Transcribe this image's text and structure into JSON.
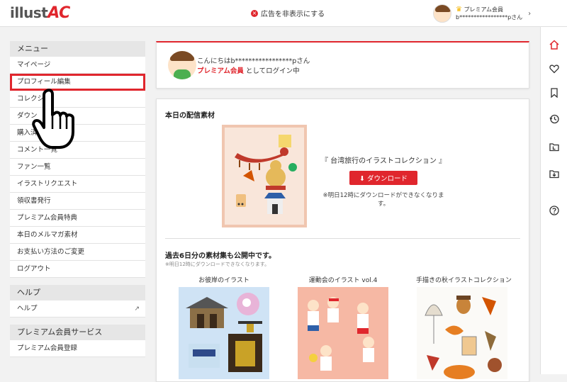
{
  "header": {
    "logo_text": "illust",
    "logo_accent": "AC",
    "hide_ads": "広告を非表示にする",
    "user_tier": "プレミアム会員",
    "user_name": "b*****************pさん"
  },
  "sidebar": {
    "menu_title": "メニュー",
    "items": [
      {
        "label": "マイページ"
      },
      {
        "label": "プロフィール編集"
      },
      {
        "label": "コレクシ"
      },
      {
        "label": "ダウン"
      },
      {
        "label": "購入済み"
      },
      {
        "label": "コメント一覧"
      },
      {
        "label": "ファン一覧"
      },
      {
        "label": "イラストリクエスト"
      },
      {
        "label": "領収書発行"
      },
      {
        "label": "プレミアム会員特典"
      },
      {
        "label": "本日のメルマガ素材"
      },
      {
        "label": "お支払い方法のご変更"
      },
      {
        "label": "ログアウト"
      }
    ],
    "help_title": "ヘルプ",
    "help_item": "ヘルプ",
    "premium_title": "プレミアム会員サービス",
    "premium_item": "プレミアム会員登録"
  },
  "welcome": {
    "greeting": "こんにちはb*****************pさん",
    "tier_link": "プレミアム会員",
    "login_suffix": "としてログイン中"
  },
  "daily": {
    "title": "本日の配信素材",
    "collection_title": "『 台湾旅行のイラストコレクション 』",
    "download_label": "ダウンロード",
    "note": "※明日12時にダウンロードができなくなります。"
  },
  "past": {
    "title": "過去6日分の素材集も公開中です。",
    "note": "※明日12時にダウンロードできなくなります。",
    "collections": [
      {
        "title": "お彼岸のイラスト"
      },
      {
        "title": "運動会のイラスト vol.4"
      },
      {
        "title": "手描きの秋イラストコレクション"
      }
    ]
  },
  "colors": {
    "accent": "#e0262d",
    "sidebar_header": "#e6e6e6"
  },
  "rail_icons": [
    "home-icon",
    "heart-icon",
    "bookmark-icon",
    "history-icon",
    "folder-l-icon",
    "folder-download-icon",
    "help-icon"
  ]
}
